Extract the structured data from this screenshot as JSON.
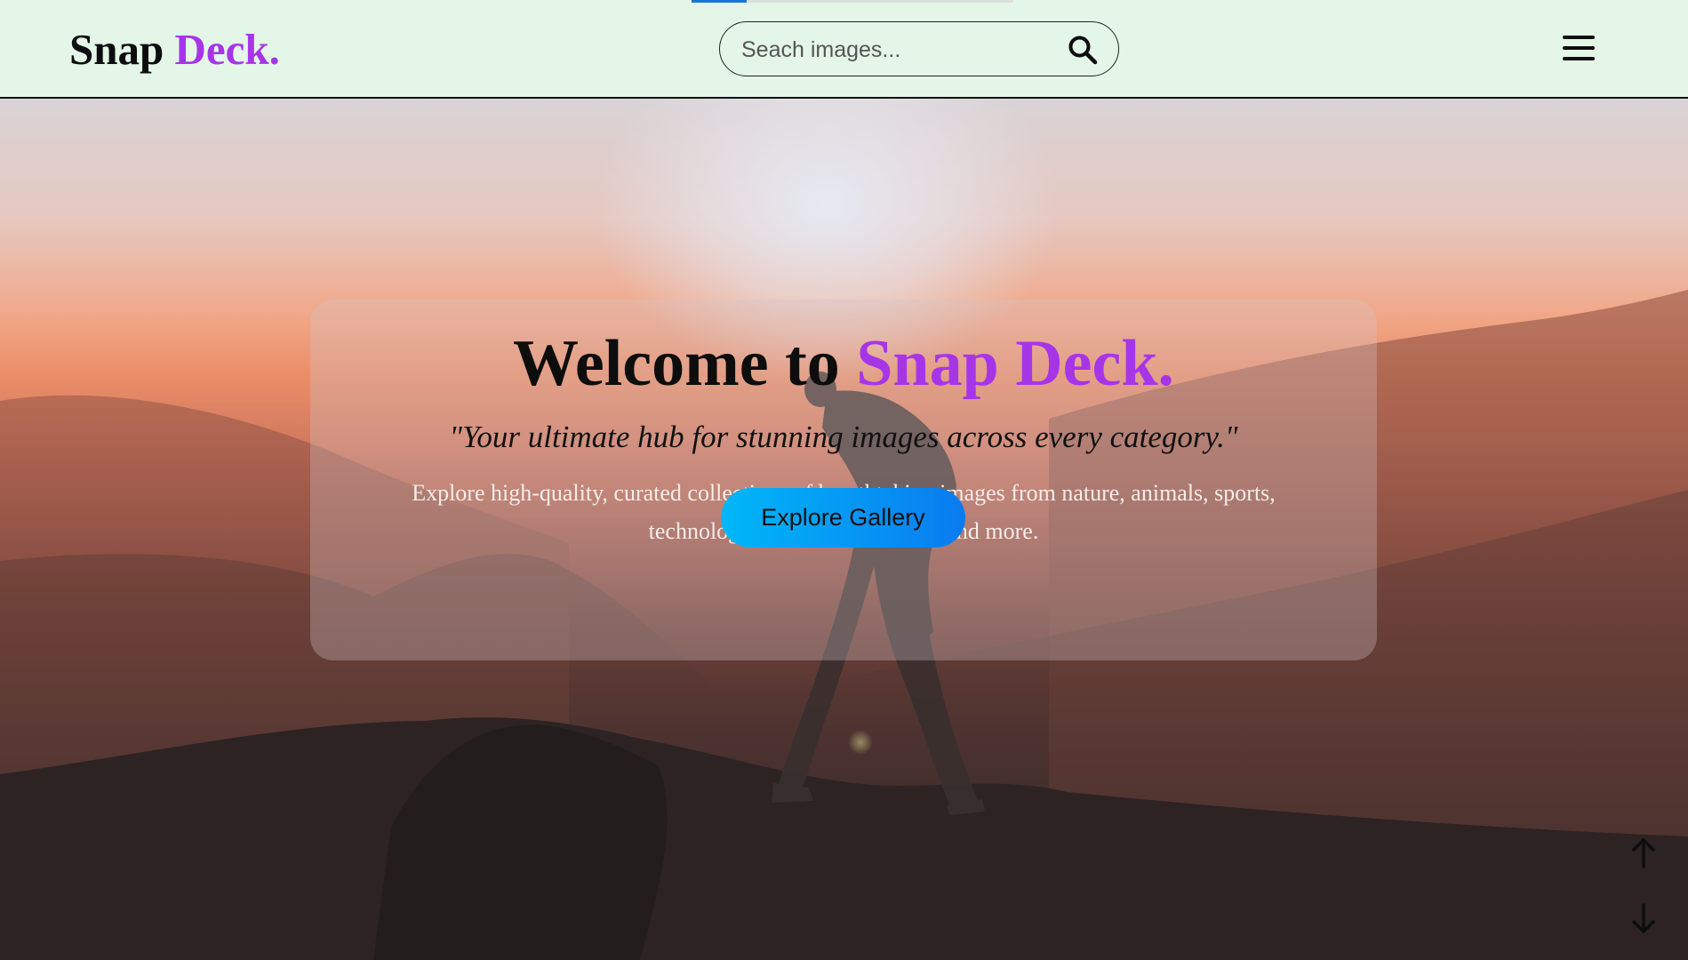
{
  "header": {
    "logo": {
      "part1": "Snap",
      "part2": "Deck."
    },
    "search": {
      "placeholder": "Seach images..."
    },
    "progress": 0.17
  },
  "hero": {
    "title": {
      "prefix": "Welcome to",
      "brand": "Snap Deck."
    },
    "tagline": "\"Your ultimate hub for stunning images across every category.\"",
    "description": "Explore high-quality, curated collections of breathtaking images from nature, animals, sports, technology, architecture, travel, and more.",
    "cta_label": "Explore Gallery"
  },
  "icons": {
    "search": "search-icon",
    "menu": "hamburger-menu-icon",
    "scroll_up": "arrow-up-icon",
    "scroll_down": "arrow-down-icon"
  },
  "colors": {
    "brand_accent": "#a735e8",
    "nav_bg": "#e3f6e8",
    "cta_start": "#00b7f8",
    "cta_end": "#0a7bf0"
  }
}
